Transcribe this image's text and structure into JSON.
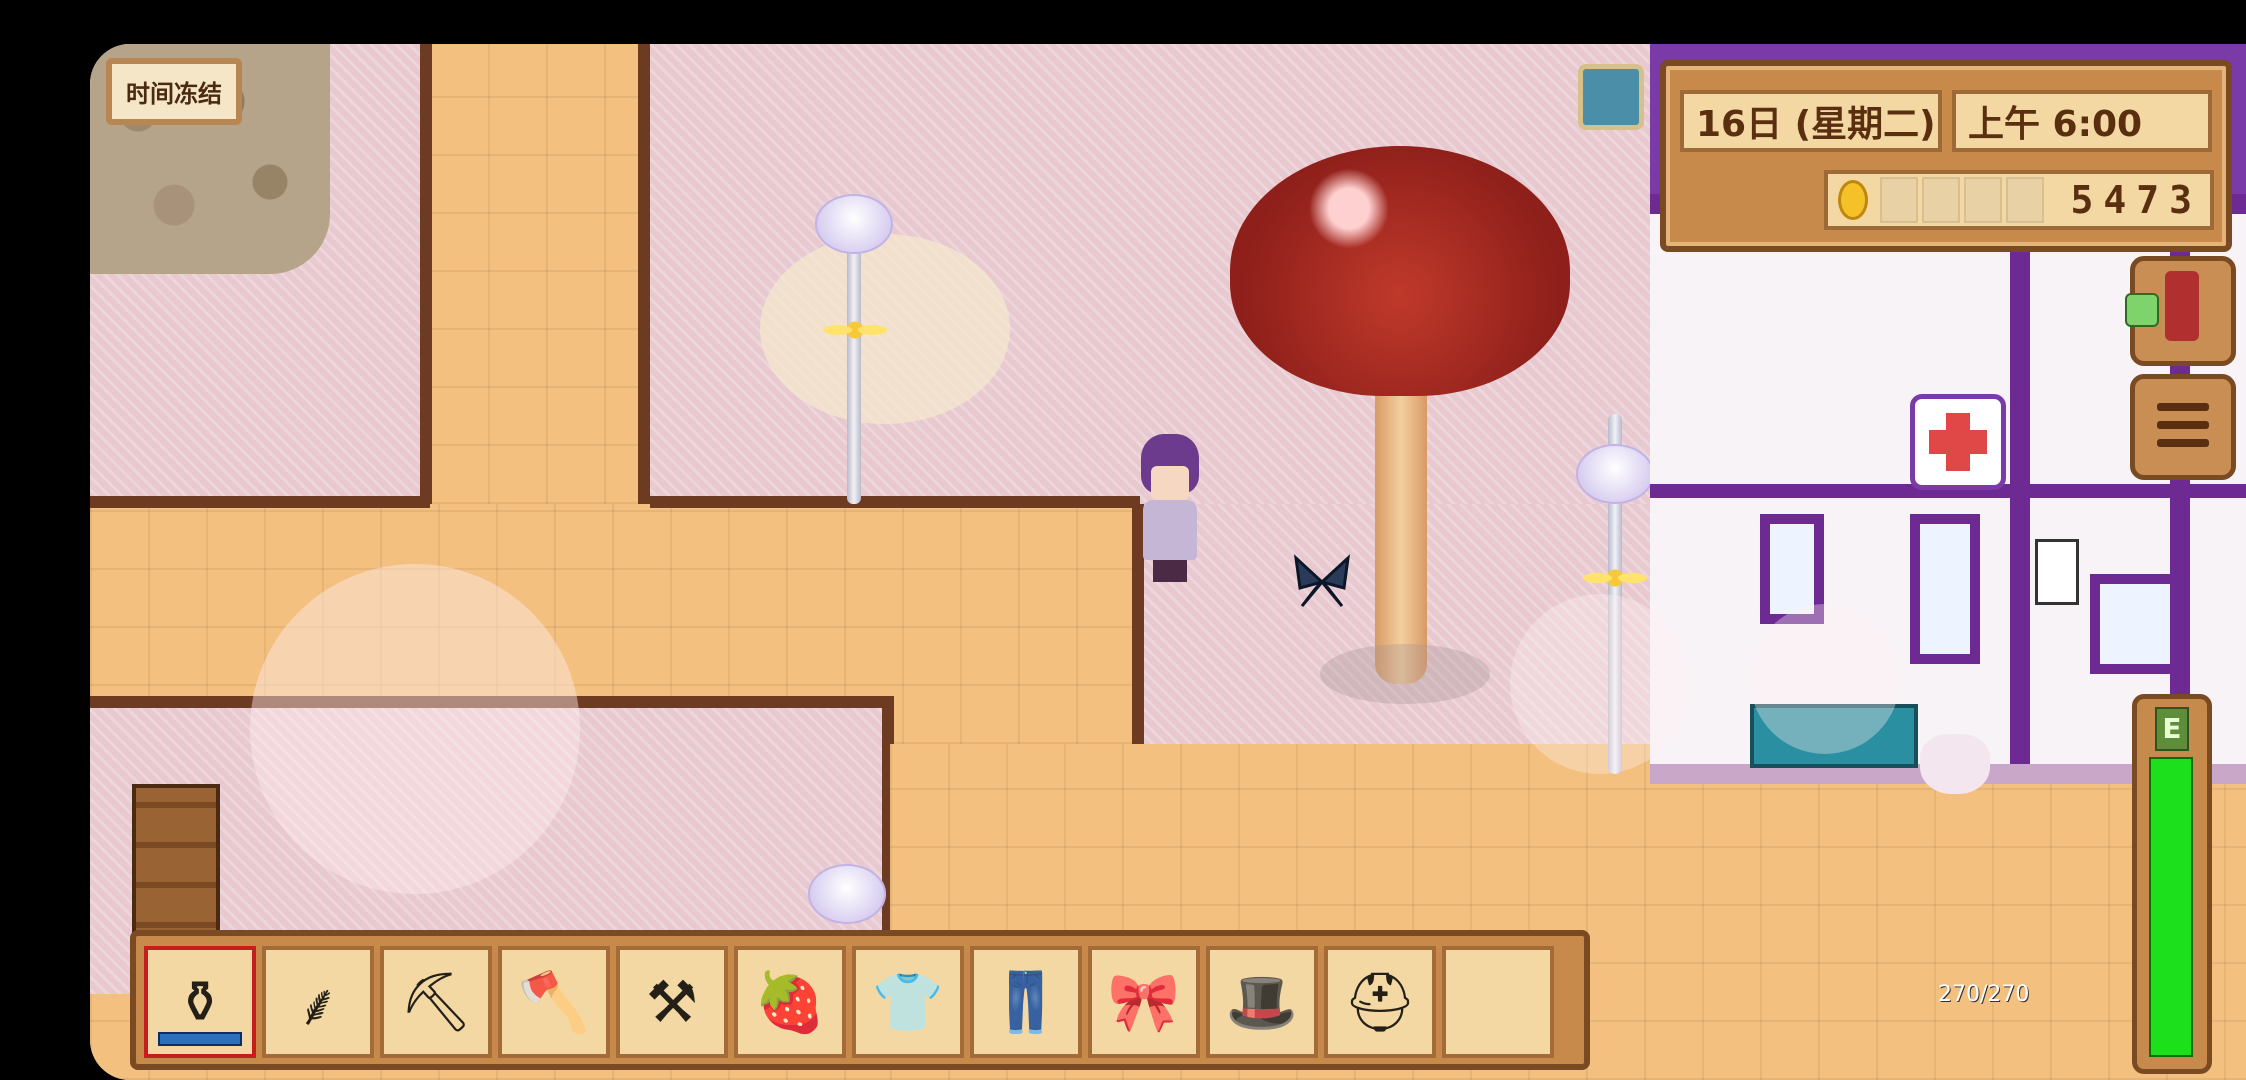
{
  "hud": {
    "time_freeze_label": "时间冻结",
    "date_label": "16日 (星期二)",
    "time_label": "上午 6:00",
    "gold_amount": "5473",
    "energy_value": 270,
    "energy_max": 270,
    "energy_text": "270/270",
    "energy_level_fraction": 1.0,
    "energy_letter": "E"
  },
  "toolbar": {
    "selected_index": 0,
    "slots": [
      {
        "item": "watering-can",
        "glyph": "⚱",
        "has_water_bar": true
      },
      {
        "item": "scythe",
        "glyph": "⸙"
      },
      {
        "item": "pickaxe",
        "glyph": "⛏"
      },
      {
        "item": "axe",
        "glyph": "🪓"
      },
      {
        "item": "hoe",
        "glyph": "⚒"
      },
      {
        "item": "strawberry",
        "glyph": "🍓"
      },
      {
        "item": "shirt",
        "glyph": "👕"
      },
      {
        "item": "pants",
        "glyph": "👖"
      },
      {
        "item": "bow-accessory",
        "glyph": "🎀"
      },
      {
        "item": "dark-hat",
        "glyph": "🎩"
      },
      {
        "item": "white-hat",
        "glyph": "⛑"
      },
      {
        "item": "empty",
        "glyph": ""
      }
    ]
  },
  "colors": {
    "energy_green": "#1de01d",
    "toolbar_frame": "#c78a4b",
    "panel_border": "#7a4a22",
    "building_purple": "#6c2a92",
    "tree_red": "#c0392b",
    "sand": "#f3c07f",
    "pink_ground": "#e7c9cf"
  },
  "icons": {
    "weather": "weather-icon",
    "journal": "journal-icon",
    "menu": "menu-icon",
    "gold": "gold-coin-icon"
  }
}
